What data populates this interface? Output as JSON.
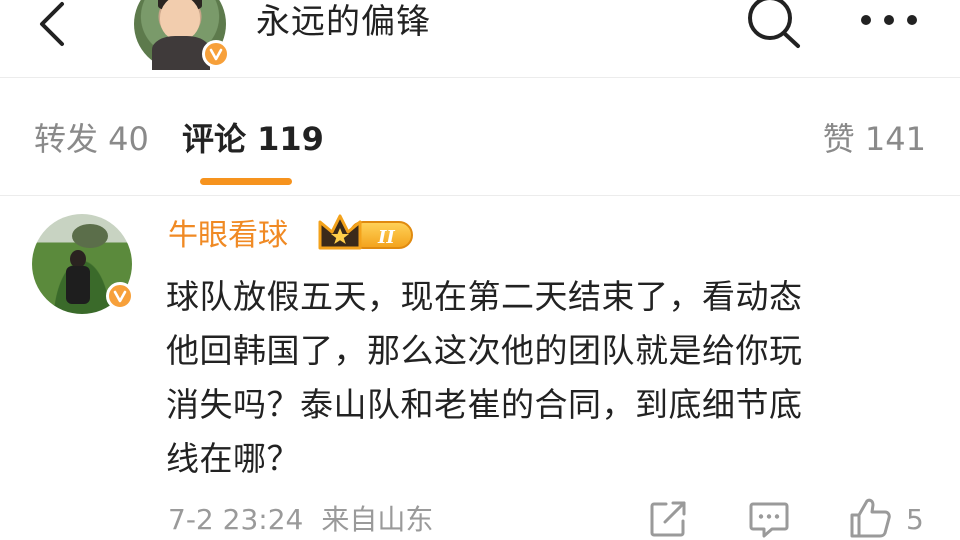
{
  "header": {
    "title": "永远的偏锋",
    "back_icon": "chevron-left-icon",
    "search_icon": "search-icon",
    "more_icon": "more-horizontal-icon",
    "verified_badge_color": "#f7a03a"
  },
  "tabs": [
    {
      "label": "转发 40",
      "active": false
    },
    {
      "label": "评论 119",
      "active": true
    },
    {
      "label": "赞 141",
      "active": false
    }
  ],
  "accent_color": "#f6931e",
  "comment": {
    "author": "牛眼看球",
    "level_badge": "II",
    "text": "球队放假五天，现在第二天结束了，看动态他回韩国了，那么这次他的团队就是给你玩消失吗？泰山队和老崔的合同，到底细节底线在哪？",
    "text_lines": [
      "球队放假五天，现在第二天结束了，看动态",
      "他回韩国了，那么这次他的团队就是给你玩",
      "消失吗？泰山队和老崔的合同，到底细节底",
      "线在哪？"
    ],
    "timestamp": "7-2 23:24",
    "source": "来自山东",
    "like_count": "5",
    "name_color": "#f08a24"
  }
}
